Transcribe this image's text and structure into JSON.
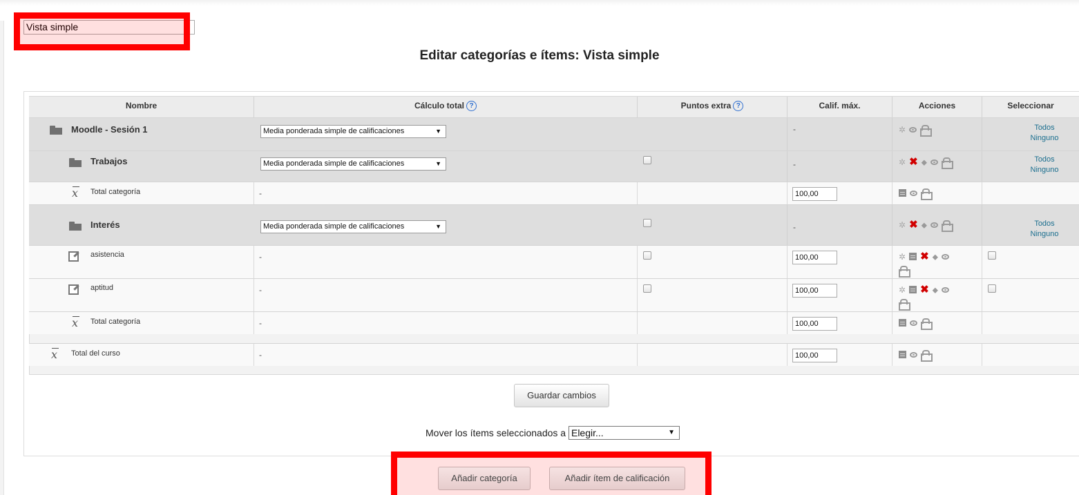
{
  "view_selector": {
    "value": "Vista simple"
  },
  "page_title": "Editar categorías e ítems: Vista simple",
  "columns": {
    "name": "Nombre",
    "calc": "Cálculo total",
    "extra": "Puntos extra",
    "max": "Calif. máx.",
    "actions": "Acciones",
    "select": "Seleccionar"
  },
  "help_glyph": "?",
  "dash": "-",
  "rows": [
    {
      "type": "category",
      "name": "Moodle - Sesión 1",
      "calc": "Media ponderada simple de calificaciones",
      "max": "-",
      "select_all": "Todos",
      "select_none": "Ninguno"
    },
    {
      "type": "category",
      "name": "Trabajos",
      "calc": "Media ponderada simple de calificaciones",
      "max": "-",
      "select_all": "Todos",
      "select_none": "Ninguno"
    },
    {
      "type": "total",
      "name": "Total categoría",
      "calc": "-",
      "max": "100,00"
    },
    {
      "type": "category",
      "name": "Interés",
      "calc": "Media ponderada simple de calificaciones",
      "max": "-",
      "select_all": "Todos",
      "select_none": "Ninguno"
    },
    {
      "type": "item",
      "name": "asistencia",
      "calc": "-",
      "max": "100,00"
    },
    {
      "type": "item",
      "name": "aptitud",
      "calc": "-",
      "max": "100,00"
    },
    {
      "type": "total",
      "name": "Total categoría",
      "calc": "-",
      "max": "100,00"
    },
    {
      "type": "total",
      "name": "Total del curso",
      "calc": "-",
      "max": "100,00"
    }
  ],
  "buttons": {
    "save": "Guardar cambios",
    "add_category": "Añadir categoría",
    "add_item": "Añadir ítem de calificación"
  },
  "move": {
    "label": "Mover los ítems seleccionados a",
    "value": "Elegir..."
  },
  "icons": [
    "gear-icon",
    "eye-icon",
    "lock-icon",
    "delete-icon",
    "move-icon",
    "calculator-icon",
    "folder-icon",
    "edit-icon",
    "mean-icon",
    "help-icon"
  ],
  "highlight_color": "#ff0000"
}
